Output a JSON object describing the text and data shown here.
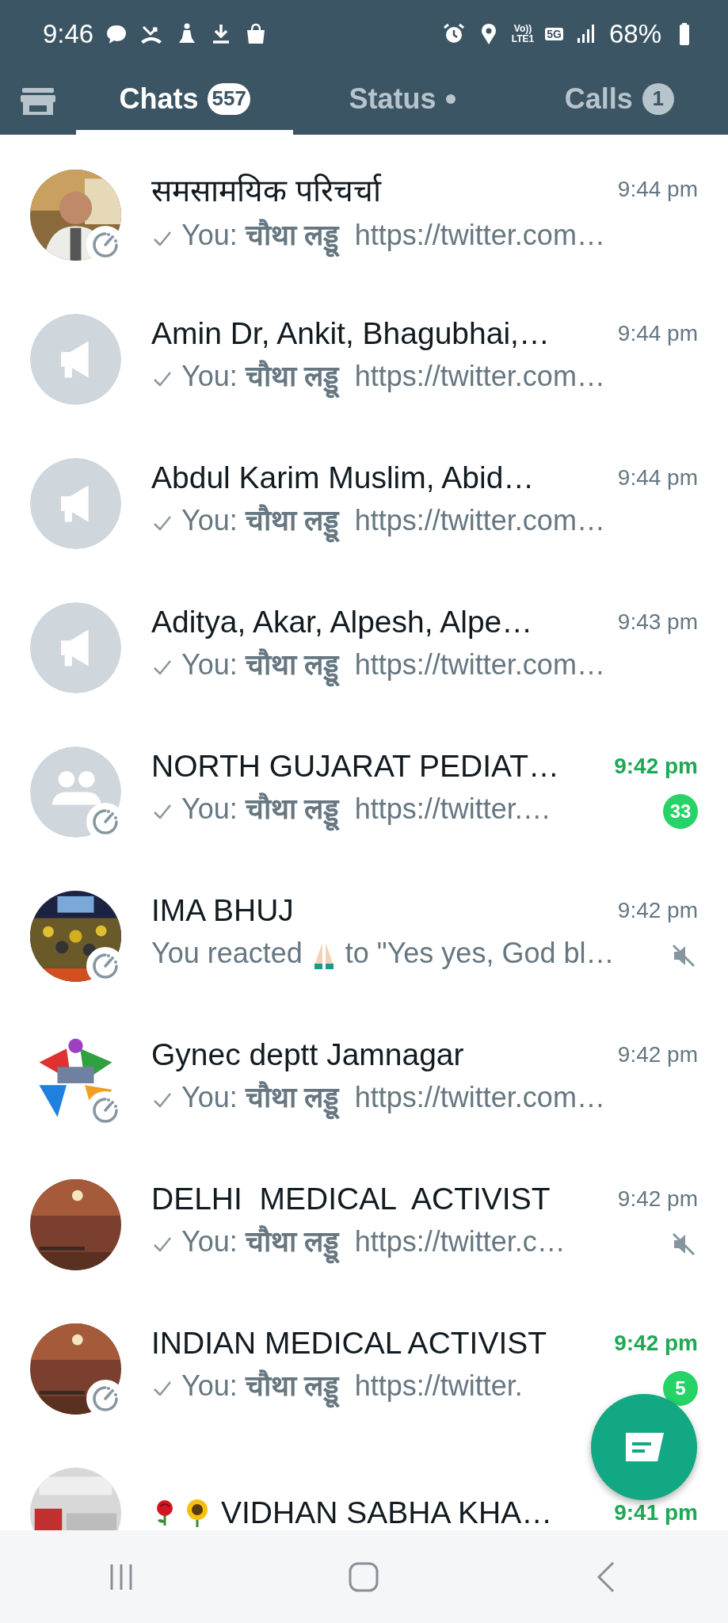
{
  "status_bar": {
    "time": "9:46",
    "volte_top": "Vo))",
    "volte_bottom": "LTE1",
    "network": "5G",
    "battery": "68%"
  },
  "tabs": [
    {
      "kind": "tab",
      "label": "Chats",
      "selected": true,
      "badge": "557"
    },
    {
      "kind": "tab",
      "label": "Status",
      "selected": false,
      "dot": true
    },
    {
      "kind": "tab",
      "label": "Calls",
      "selected": false,
      "badge": "1"
    }
  ],
  "chats": [
    {
      "kind": "portrait",
      "timer": true,
      "title": "समसामयिक परिचर्चा",
      "time": "9:44 pm",
      "unread": false,
      "sent": true,
      "preview": "You: **चौथा लड्डू**  https://twitter.com…",
      "muted": false
    },
    {
      "kind": "broadcast",
      "timer": false,
      "title": "Amin Dr, Ankit, Bhagubhai,…",
      "time": "9:44 pm",
      "unread": false,
      "sent": true,
      "preview": "You: **चौथा लड्डू**  https://twitter.com…",
      "muted": false
    },
    {
      "kind": "broadcast",
      "timer": false,
      "title": "Abdul Karim Muslim, Abid…",
      "time": "9:44 pm",
      "unread": false,
      "sent": true,
      "preview": "You: **चौथा लड्डू**  https://twitter.com…",
      "muted": false
    },
    {
      "kind": "broadcast",
      "timer": false,
      "title": "Aditya, Akar, Alpesh, Alpe…",
      "time": "9:43 pm",
      "unread": false,
      "sent": true,
      "preview": "You: **चौथा लड्डू**  https://twitter.com…",
      "muted": false
    },
    {
      "kind": "group",
      "timer": true,
      "title": "NORTH GUJARAT PEDIAT…",
      "time": "9:42 pm",
      "unread": true,
      "sent": true,
      "preview": "You: **चौथा लड्डू**  https://twitter.…",
      "muted": false,
      "badge": "33"
    },
    {
      "kind": "crowd",
      "timer": true,
      "title": "IMA BHUJ",
      "time": "9:42 pm",
      "unread": false,
      "sent": false,
      "preview": "You reacted",
      "reaction": true,
      "preview_after": "to \"Yes yes, God bl…",
      "muted": true
    },
    {
      "kind": "logo",
      "timer": true,
      "title": "Gynec deptt Jamnagar",
      "time": "9:42 pm",
      "unread": false,
      "sent": true,
      "preview": "You: **चौथा लड्डू**  https://twitter.com…",
      "muted": false
    },
    {
      "kind": "sunset",
      "timer": false,
      "title": "DELHI  MEDICAL  ACTIVIST",
      "time": "9:42 pm",
      "unread": false,
      "sent": true,
      "preview": "You: **चौथा लड्डू**  https://twitter.c…",
      "muted": true
    },
    {
      "kind": "sunset",
      "timer": true,
      "title": "INDIAN MEDICAL ACTIVIST",
      "time": "9:42 pm",
      "unread": true,
      "sent": true,
      "preview": "You: **चौथा लड्डू**  https://twitter.",
      "muted": false,
      "badge": "5"
    },
    {
      "kind": "poster",
      "timer": false,
      "title": "VIDHAN SABHA KHA…",
      "decorated": true,
      "time": "9:41 pm",
      "unread": true,
      "sent": false,
      "muted": false
    }
  ]
}
